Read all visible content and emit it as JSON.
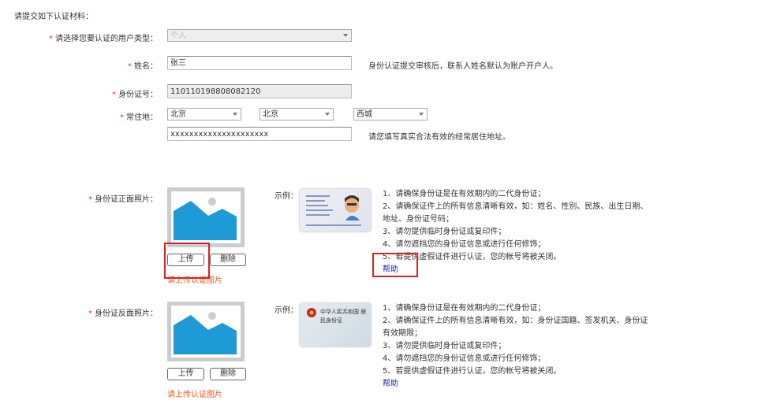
{
  "heading": "请提交如下认证材料：",
  "fields": {
    "user_type": {
      "label": "请选择您要认证的用户类型：",
      "value": "个人"
    },
    "name": {
      "label": "姓名：",
      "value": "张三",
      "hint": "身份认证提交审核后，联系人姓名默认为账户开户人。"
    },
    "id_number": {
      "label": "身份证号：",
      "value": "110110198808082120"
    },
    "residence": {
      "label": "常住地：",
      "province": "北京",
      "city": "北京",
      "district": "西城",
      "address": "xxxxxxxxxxxxxxxxxxxxx",
      "hint": "请您填写真实合法有效的经常居住地址。"
    }
  },
  "front": {
    "label": "身份证正面照片：",
    "upload": "上传",
    "delete": "删除",
    "error": "请上传认证图片",
    "example_label": "示例：",
    "notes": [
      "1、请确保身份证是在有效期内的二代身份证；",
      "2、请确保证件上的所有信息清晰有效，如：姓名、性别、民族、出生日期、地址、身份证号码；",
      "3、请勿提供临时身份证或复印件；",
      "4、请勿遮挡您的身份证信息或进行任何修饰；",
      "5、若提供虚假证件进行认证，您的帐号将被关闭。"
    ],
    "help": "帮助"
  },
  "back": {
    "label": "身份证反面照片：",
    "upload": "上传",
    "delete": "删除",
    "error": "请上传认证图片",
    "example_label": "示例：",
    "card_text": "中华人民共和国 居民身份证",
    "notes": [
      "1、请确保身份证是在有效期内的二代身份证；",
      "2、请确保证件上的所有信息清晰有效，如：身份证国籍、签发机关、身份证有效期限；",
      "3、请勿提供临时身份证或复印件；",
      "4、请勿遮挡您的身份证信息或进行任何修饰；",
      "5、若提供虚假证件进行认证，您的帐号将被关闭。"
    ],
    "help": "帮助"
  },
  "colors": {
    "required": "#ee3333",
    "error": "#f05a1a",
    "link": "#1a1acc",
    "highlight": "#e02020",
    "image_blue": "#1e9ad6"
  }
}
